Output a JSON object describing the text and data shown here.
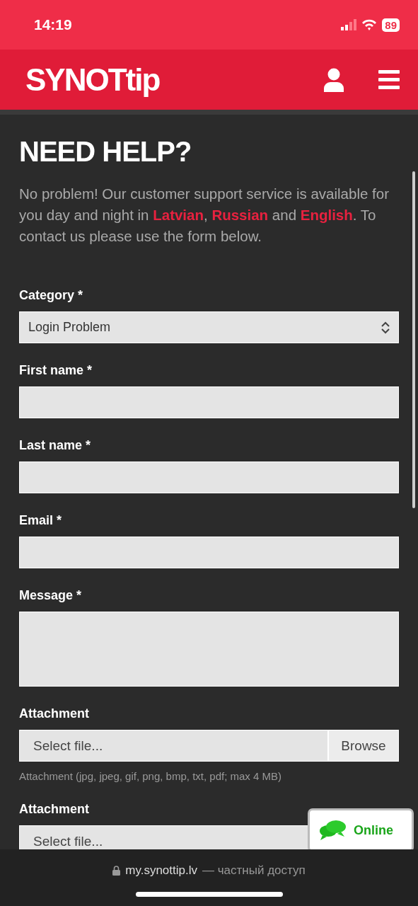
{
  "status_bar": {
    "time": "14:19",
    "battery": "89"
  },
  "header": {
    "logo": "SYNOTtip"
  },
  "title": "NEED HELP?",
  "intro": "No problem! Our customer support service is available for you day and night in **Latvian**, **Russian** and **English**. To contact us please use the form below.",
  "form": [
    {
      "kind": "select",
      "label": "Category *",
      "value": "Login Problem"
    },
    {
      "kind": "text",
      "label": "First name *"
    },
    {
      "kind": "text",
      "label": "Last name *"
    },
    {
      "kind": "text",
      "label": "Email *"
    },
    {
      "kind": "textarea",
      "label": "Message *"
    },
    {
      "kind": "file",
      "label": "Attachment",
      "placeholder": "Select file...",
      "button": "Browse",
      "hint": "Attachment (jpg, jpeg, gif, png, bmp, txt, pdf; max 4 MB)"
    },
    {
      "kind": "file",
      "label": "Attachment",
      "placeholder": "Select file..."
    }
  ],
  "chat_widget": {
    "label": "Online"
  },
  "browser_bar": {
    "domain": "my.synottip.lv",
    "suffix": "— частный доступ"
  }
}
